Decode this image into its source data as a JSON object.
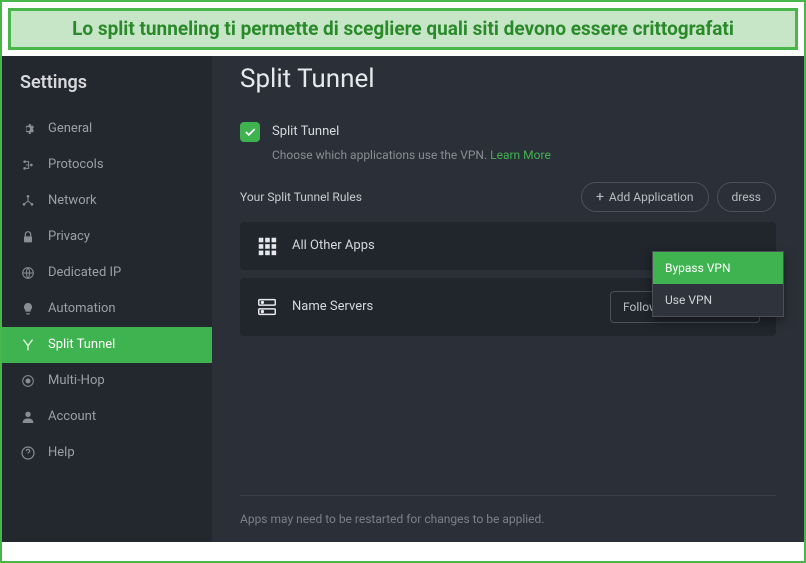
{
  "banner": {
    "text": "Lo split tunneling ti permette di scegliere quali siti devono essere crittografati"
  },
  "sidebar": {
    "title": "Settings",
    "items": [
      {
        "label": "General"
      },
      {
        "label": "Protocols"
      },
      {
        "label": "Network"
      },
      {
        "label": "Privacy"
      },
      {
        "label": "Dedicated IP"
      },
      {
        "label": "Automation"
      },
      {
        "label": "Split Tunnel"
      },
      {
        "label": "Multi-Hop"
      },
      {
        "label": "Account"
      },
      {
        "label": "Help"
      }
    ]
  },
  "main": {
    "title": "Split Tunnel",
    "toggle_label": "Split Tunnel",
    "hint_text": "Choose which applications use the VPN.",
    "learn_more": "Learn More",
    "rules_label": "Your Split Tunnel Rules",
    "add_app": "Add Application",
    "add_ip": "dress",
    "rules": [
      {
        "label": "All Other Apps"
      },
      {
        "label": "Name Servers"
      }
    ],
    "name_servers_value": "Follow App Rules",
    "dropdown_options": [
      {
        "label": "Bypass VPN",
        "selected": true
      },
      {
        "label": "Use VPN",
        "selected": false
      }
    ],
    "footer": "Apps may need to be restarted for changes to be applied."
  }
}
